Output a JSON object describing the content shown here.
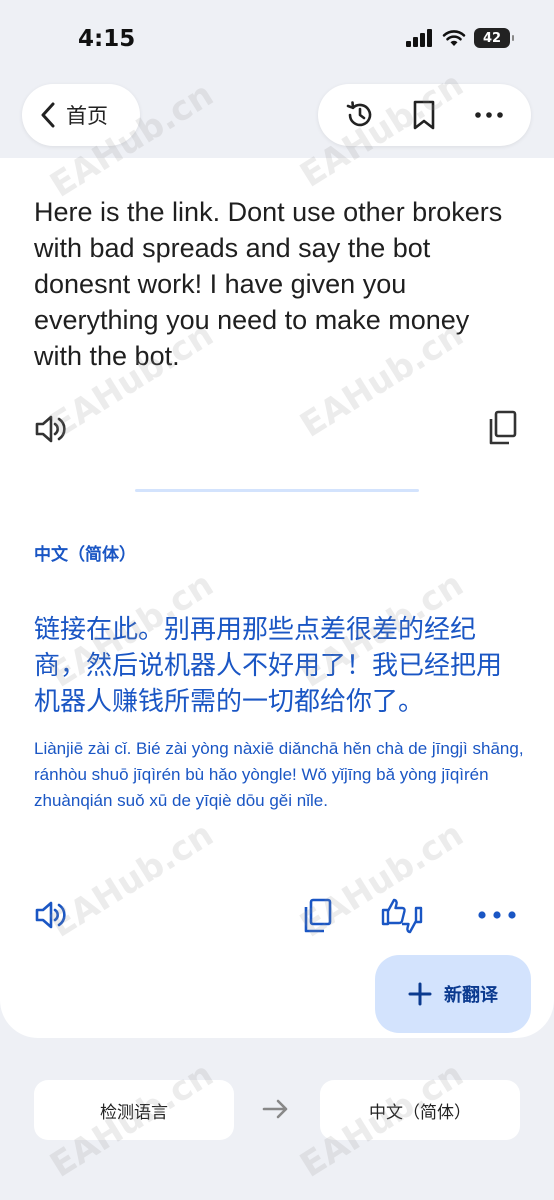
{
  "status_bar": {
    "time": "4:15",
    "battery": "42"
  },
  "nav": {
    "back_label": "首页"
  },
  "source": {
    "text": "Here is the link. Dont use other brokers with bad spreads and say the bot donesnt work! I have given you everything you need to make money with the bot."
  },
  "target": {
    "language": "中文（简体）",
    "text": "链接在此。别再用那些点差很差的经纪商，然后说机器人不好用了！我已经把用机器人赚钱所需的一切都给你了。",
    "romanization": "Liànjiē zài cǐ. Bié zài yòng nàxiē diǎnchā hěn chà de jīngjì shāng, ránhòu shuō jīqìrén bù hǎo yòngle! Wǒ yǐjīng bǎ yòng jīqìrén zhuànqián suǒ xū de yīqiè dōu gěi nǐle."
  },
  "fab": {
    "label": "新翻译"
  },
  "language_bar": {
    "source_label": "检测语言",
    "target_label": "中文（简体）"
  },
  "watermark": "EAHub.cn",
  "colors": {
    "accent": "#1a56c4",
    "fab_bg": "#d3e3fd",
    "page_bg": "#eef0f5"
  }
}
